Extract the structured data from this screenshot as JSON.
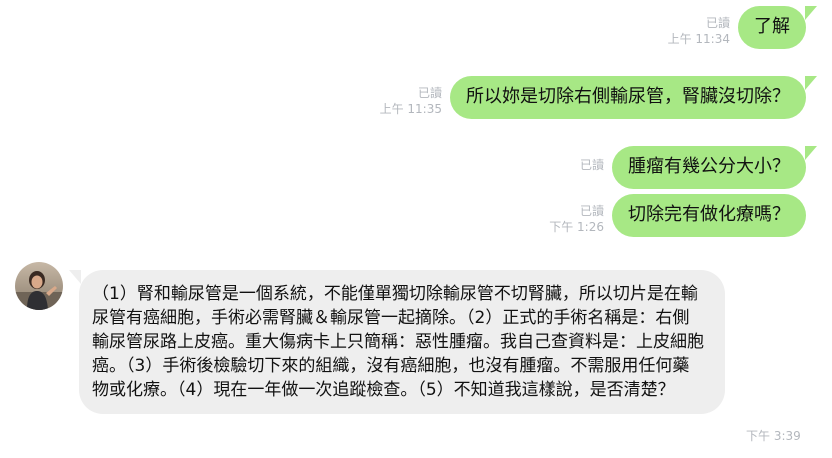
{
  "messages_out": [
    {
      "read": "已讀",
      "time": "上午 11:34",
      "text": "了解"
    },
    {
      "read": "已讀",
      "time": "上午 11:35",
      "text": "所以妳是切除右側輸尿管，腎臟沒切除？"
    },
    {
      "read": "已讀",
      "time": "",
      "text": "腫瘤有幾公分大小？"
    },
    {
      "read": "已讀",
      "time": "下午 1:26",
      "text": "切除完有做化療嗎？"
    }
  ],
  "message_in": {
    "text": "（1）腎和輸尿管是一個系統，不能僅單獨切除輸尿管不切腎臟，所以切片是在輸尿管有癌細胞，手術必需腎臟＆輸尿管一起摘除。（2）正式的手術名稱是：右側輸尿管尿路上皮癌。重大傷病卡上只簡稱：惡性腫瘤。我自己查資料是：上皮細胞癌。（3）手術後檢驗切下來的組織，沒有癌細胞，也沒有腫瘤。不需服用任何藥物或化療。（4）現在一年做一次追蹤檢查。（5）不知道我這樣說，是否清楚？",
    "time": "下午 3:39"
  },
  "colors": {
    "outgoing_bubble": "#a7e885",
    "incoming_bubble": "#eeeeee",
    "meta_text": "#b3b7bd"
  }
}
